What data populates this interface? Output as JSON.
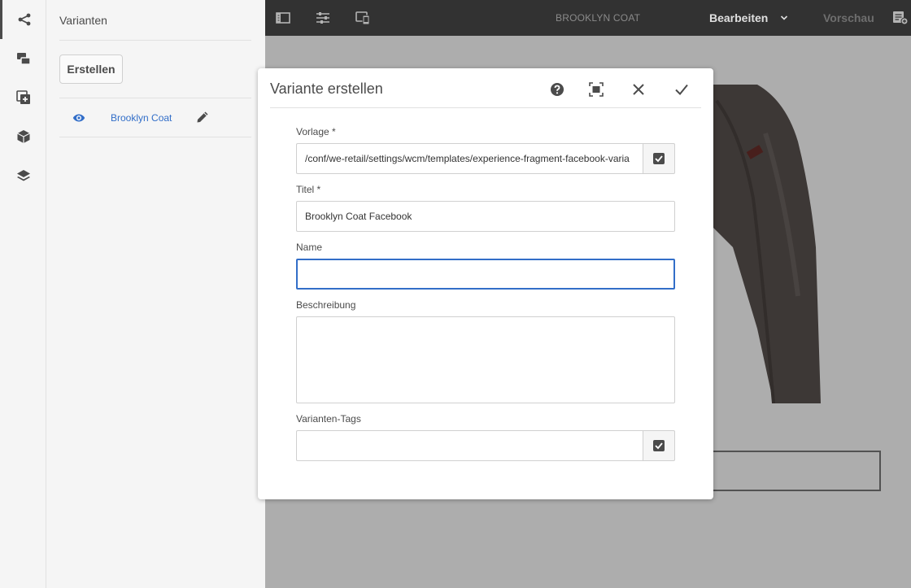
{
  "sidebar": {
    "rail": [
      {
        "icon": "share-tree-icon",
        "active": true
      },
      {
        "icon": "components-icon",
        "active": false
      },
      {
        "icon": "add-asset-icon",
        "active": false
      },
      {
        "icon": "box-icon",
        "active": false
      },
      {
        "icon": "layers-icon",
        "active": false
      }
    ],
    "panel_title": "Varianten",
    "create_label": "Erstellen",
    "variants": [
      {
        "label": "Brooklyn Coat",
        "icon": "eye-icon",
        "action_icon": "pencil-icon"
      }
    ]
  },
  "topbar": {
    "title": "BROOKLYN COAT",
    "mode_label": "Bearbeiten",
    "preview_label": "Vorschau",
    "icons": [
      "side-panel-icon",
      "properties-icon",
      "emulator-icon",
      "annotations-icon"
    ]
  },
  "dialog": {
    "title": "Variante erstellen",
    "buttons": [
      "help-icon",
      "fullscreen-icon",
      "close-icon",
      "confirm-icon"
    ],
    "fields": {
      "template": {
        "label": "Vorlage *",
        "value": "/conf/we-retail/settings/wcm/templates/experience-fragment-facebook-varia"
      },
      "title": {
        "label": "Titel *",
        "value": "Brooklyn Coat Facebook"
      },
      "name": {
        "label": "Name",
        "value": ""
      },
      "description": {
        "label": "Beschreibung",
        "value": ""
      },
      "tags": {
        "label": "Varianten-Tags",
        "value": ""
      }
    }
  },
  "colors": {
    "topbar_bg": "#323232",
    "accent_blue": "#326ec8",
    "panel_bg": "#f5f5f5"
  }
}
